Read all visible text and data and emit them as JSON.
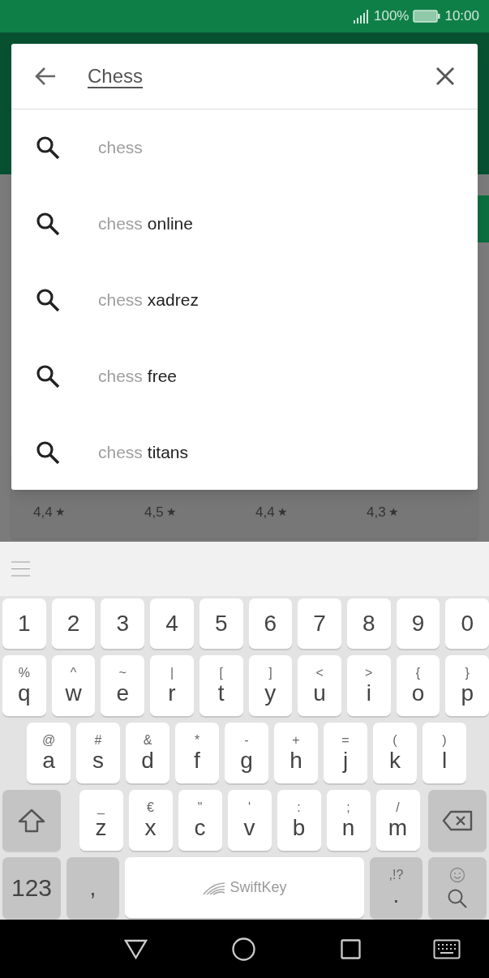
{
  "status_bar": {
    "battery": "100%",
    "time": "10:00"
  },
  "search": {
    "query": "Chess"
  },
  "suggestions": [
    {
      "typed": "chess"
    },
    {
      "typed": "chess",
      "completion": "online"
    },
    {
      "typed": "chess",
      "completion": "xadrez"
    },
    {
      "typed": "chess",
      "completion": "free"
    },
    {
      "typed": "chess",
      "completion": "titans"
    }
  ],
  "background_ratings": [
    {
      "value": "4,4",
      "star": "★"
    },
    {
      "value": "4,5",
      "star": "★"
    },
    {
      "value": "4,4",
      "star": "★"
    },
    {
      "value": "4,3",
      "star": "★"
    }
  ],
  "keyboard": {
    "rows": [
      [
        {
          "kind": "key",
          "main": "1"
        },
        {
          "kind": "key",
          "main": "2"
        },
        {
          "kind": "key",
          "main": "3"
        },
        {
          "kind": "key",
          "main": "4"
        },
        {
          "kind": "key",
          "main": "5"
        },
        {
          "kind": "key",
          "main": "6"
        },
        {
          "kind": "key",
          "main": "7"
        },
        {
          "kind": "key",
          "main": "8"
        },
        {
          "kind": "key",
          "main": "9"
        },
        {
          "kind": "key",
          "main": "0"
        }
      ],
      [
        {
          "kind": "key",
          "main": "q",
          "alt": "%"
        },
        {
          "kind": "key",
          "main": "w",
          "alt": "^"
        },
        {
          "kind": "key",
          "main": "e",
          "alt": "~"
        },
        {
          "kind": "key",
          "main": "r",
          "alt": "|"
        },
        {
          "kind": "key",
          "main": "t",
          "alt": "["
        },
        {
          "kind": "key",
          "main": "y",
          "alt": "]"
        },
        {
          "kind": "key",
          "main": "u",
          "alt": "<"
        },
        {
          "kind": "key",
          "main": "i",
          "alt": ">"
        },
        {
          "kind": "key",
          "main": "o",
          "alt": "{"
        },
        {
          "kind": "key",
          "main": "p",
          "alt": "}"
        }
      ],
      [
        {
          "kind": "key",
          "main": "a",
          "alt": "@"
        },
        {
          "kind": "key",
          "main": "s",
          "alt": "#"
        },
        {
          "kind": "key",
          "main": "d",
          "alt": "&"
        },
        {
          "kind": "key",
          "main": "f",
          "alt": "*"
        },
        {
          "kind": "key",
          "main": "g",
          "alt": "-"
        },
        {
          "kind": "key",
          "main": "h",
          "alt": "+"
        },
        {
          "kind": "key",
          "main": "j",
          "alt": "="
        },
        {
          "kind": "key",
          "main": "k",
          "alt": "("
        },
        {
          "kind": "key",
          "main": "l",
          "alt": ")"
        }
      ],
      [
        {
          "kind": "shift"
        },
        {
          "kind": "key",
          "main": "z",
          "alt": "_"
        },
        {
          "kind": "key",
          "main": "x",
          "alt": "€"
        },
        {
          "kind": "key",
          "main": "c",
          "alt": "\""
        },
        {
          "kind": "key",
          "main": "v",
          "alt": "'"
        },
        {
          "kind": "key",
          "main": "b",
          "alt": ":"
        },
        {
          "kind": "key",
          "main": "n",
          "alt": ";"
        },
        {
          "kind": "key",
          "main": "m",
          "alt": "/"
        },
        {
          "kind": "backspace"
        }
      ],
      [
        {
          "kind": "mode",
          "main": "123"
        },
        {
          "kind": "function",
          "main": ","
        },
        {
          "kind": "space",
          "main": "SwiftKey"
        },
        {
          "kind": "function",
          "main": ".",
          "alt": ",!?"
        },
        {
          "kind": "search"
        }
      ]
    ]
  }
}
